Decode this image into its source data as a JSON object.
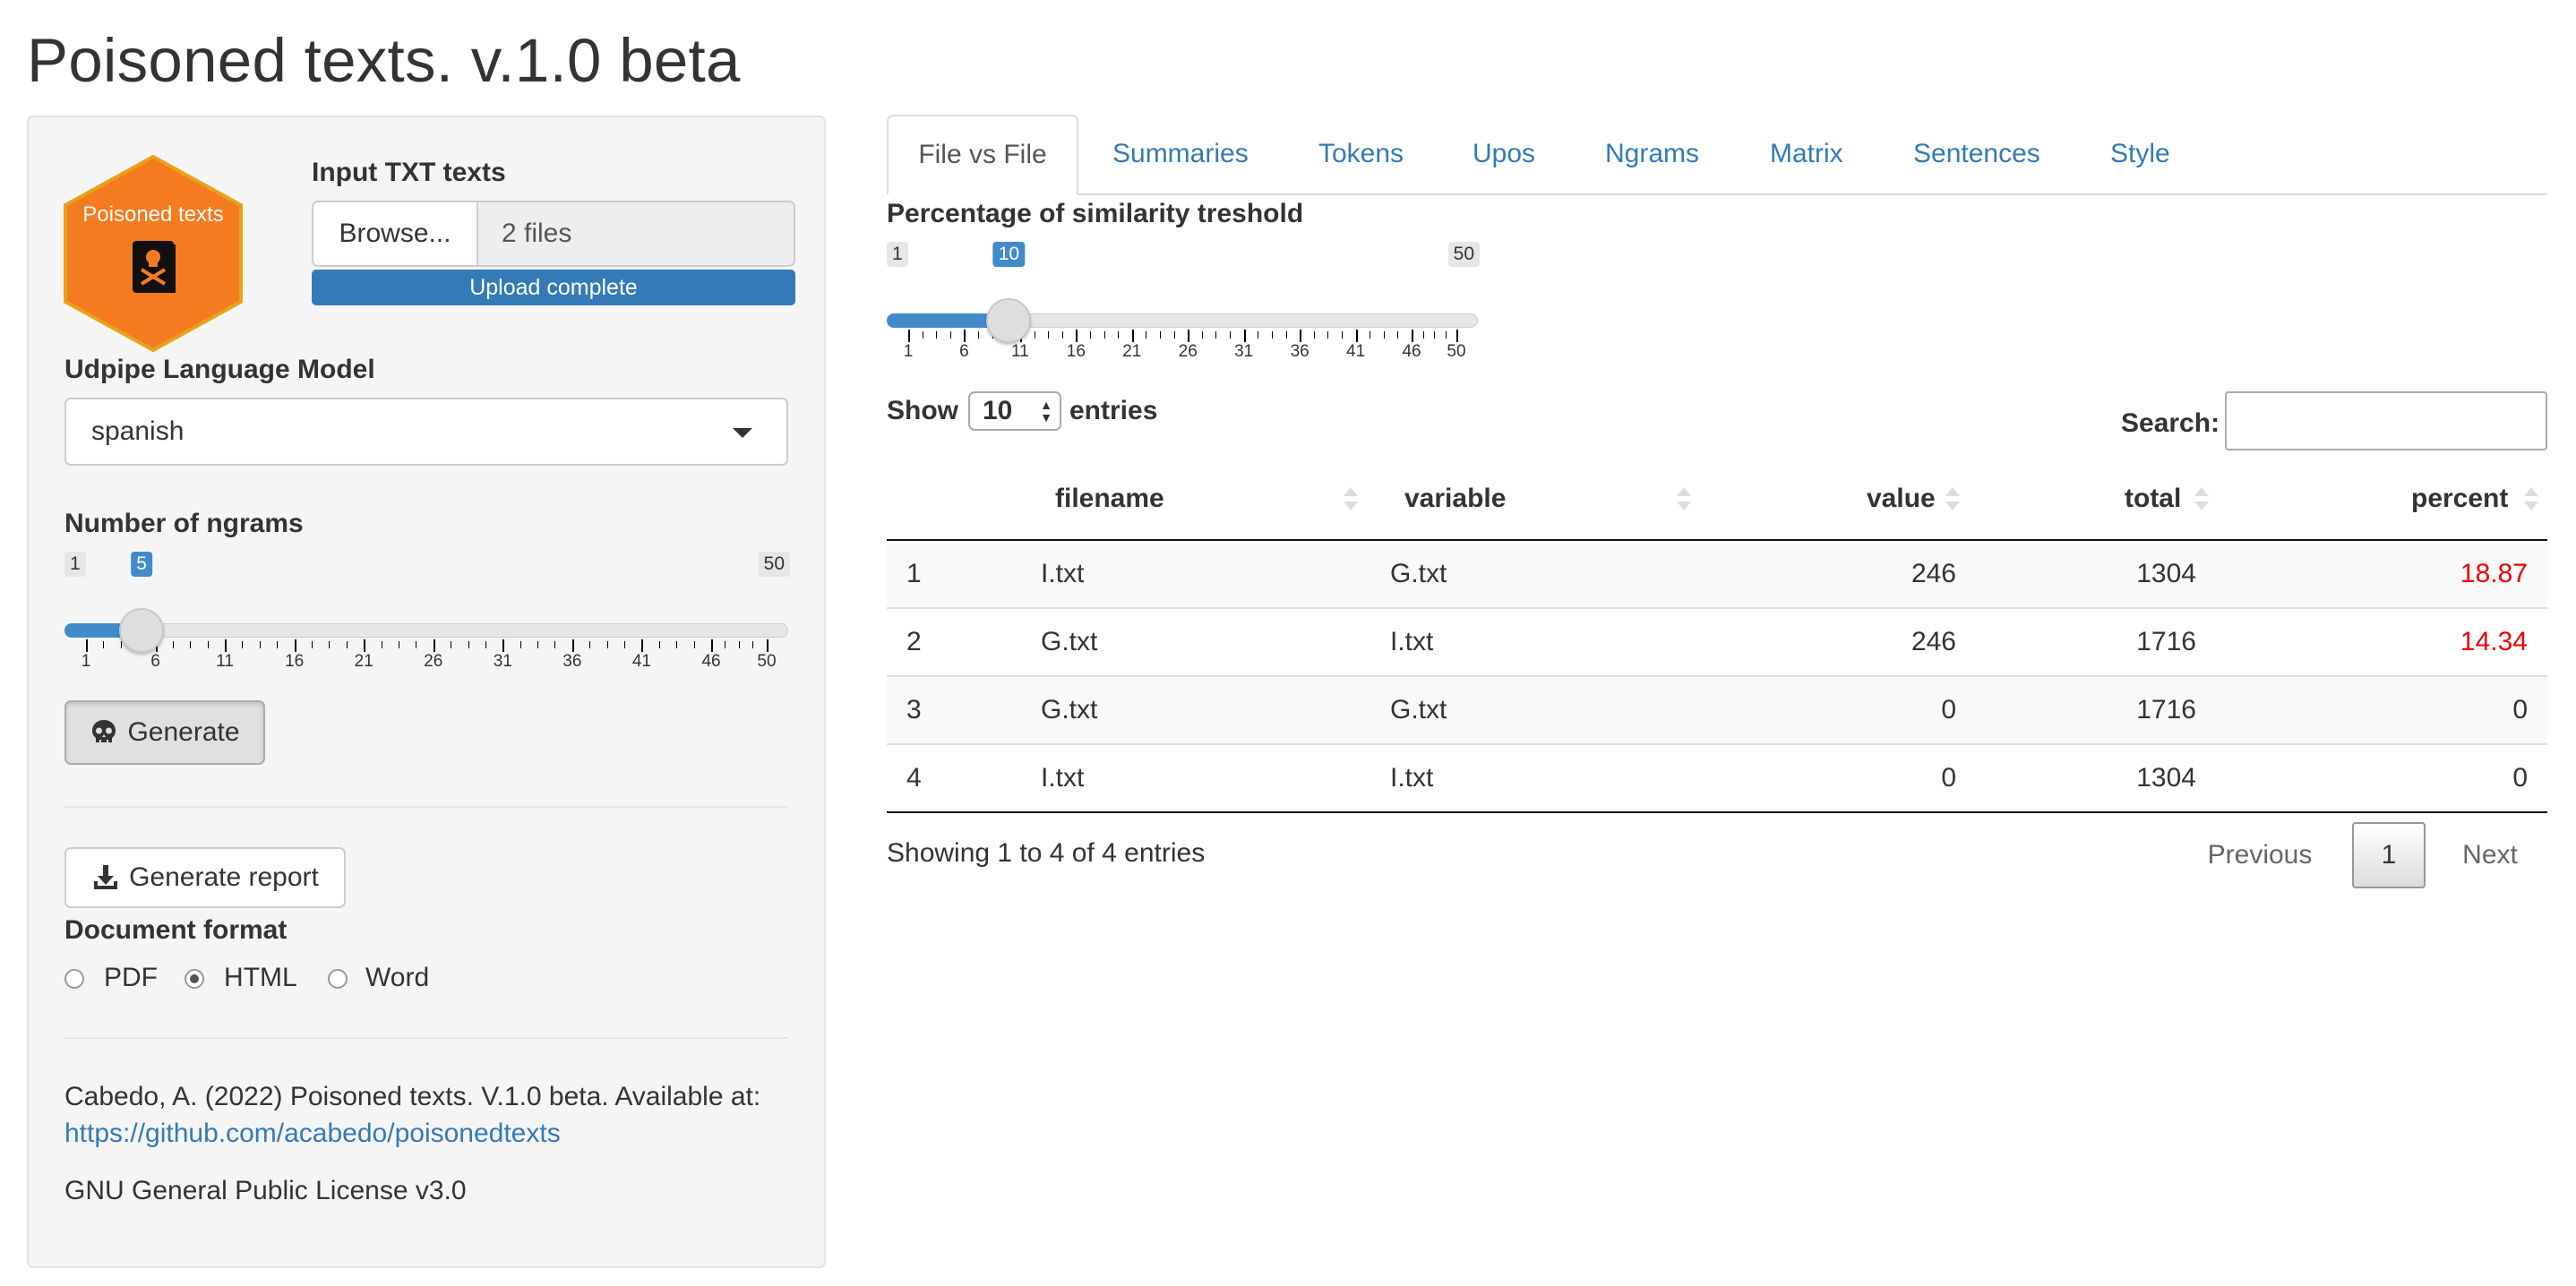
{
  "app": {
    "title": "Poisoned texts. v.1.0 beta"
  },
  "logo": {
    "text": "Poisoned texts"
  },
  "sidebar": {
    "input_label": "Input TXT texts",
    "browse_label": "Browse...",
    "file_value": "2 files",
    "upload_status": "Upload complete",
    "model_label": "Udpipe Language Model",
    "model_value": "spanish",
    "ngrams_label": "Number of ngrams",
    "ngrams_slider": {
      "min": "1",
      "max": "50",
      "value": "5",
      "value_num": 5,
      "tick_labels": [
        "1",
        "6",
        "11",
        "16",
        "21",
        "26",
        "31",
        "36",
        "41",
        "46",
        "50"
      ]
    },
    "generate_label": "Generate",
    "report_label": "Generate report",
    "format_label": "Document format",
    "formats": [
      {
        "label": "PDF",
        "selected": false
      },
      {
        "label": "HTML",
        "selected": true
      },
      {
        "label": "Word",
        "selected": false
      }
    ],
    "citation": "Cabedo, A. (2022) Poisoned texts. V.1.0 beta. Available at:",
    "citation_link": "https://github.com/acabedo/poisonedtexts",
    "license": "GNU General Public License v3.0"
  },
  "tabs": [
    {
      "label": "File vs File",
      "active": true
    },
    {
      "label": "Summaries"
    },
    {
      "label": "Tokens"
    },
    {
      "label": "Upos"
    },
    {
      "label": "Ngrams"
    },
    {
      "label": "Matrix"
    },
    {
      "label": "Sentences"
    },
    {
      "label": "Style"
    }
  ],
  "similarity": {
    "label": "Percentage of similarity treshold",
    "slider": {
      "min": "1",
      "max": "50",
      "value": "10",
      "value_num": 10,
      "tick_labels": [
        "1",
        "6",
        "11",
        "16",
        "21",
        "26",
        "31",
        "36",
        "41",
        "46",
        "50"
      ]
    }
  },
  "table": {
    "show_label": "Show",
    "page_length": "10",
    "entries_label": "entries",
    "search_label": "Search:",
    "columns": [
      "",
      "filename",
      "variable",
      "value",
      "total",
      "percent"
    ],
    "rows": [
      {
        "idx": "1",
        "filename": "I.txt",
        "variable": "G.txt",
        "value": "246",
        "total": "1304",
        "percent": "18.87"
      },
      {
        "idx": "2",
        "filename": "G.txt",
        "variable": "I.txt",
        "value": "246",
        "total": "1716",
        "percent": "14.34"
      },
      {
        "idx": "3",
        "filename": "G.txt",
        "variable": "G.txt",
        "value": "0",
        "total": "1716",
        "percent": "0"
      },
      {
        "idx": "4",
        "filename": "I.txt",
        "variable": "I.txt",
        "value": "0",
        "total": "1304",
        "percent": "0"
      }
    ],
    "highlight_color": "#ee0000",
    "info": "Showing 1 to 4 of 4 entries",
    "pagination": {
      "previous": "Previous",
      "current": "1",
      "next": "Next"
    }
  },
  "colors": {
    "accent": "#337ab7",
    "slider": "#428bca",
    "logo_orange": "#f47b20"
  }
}
